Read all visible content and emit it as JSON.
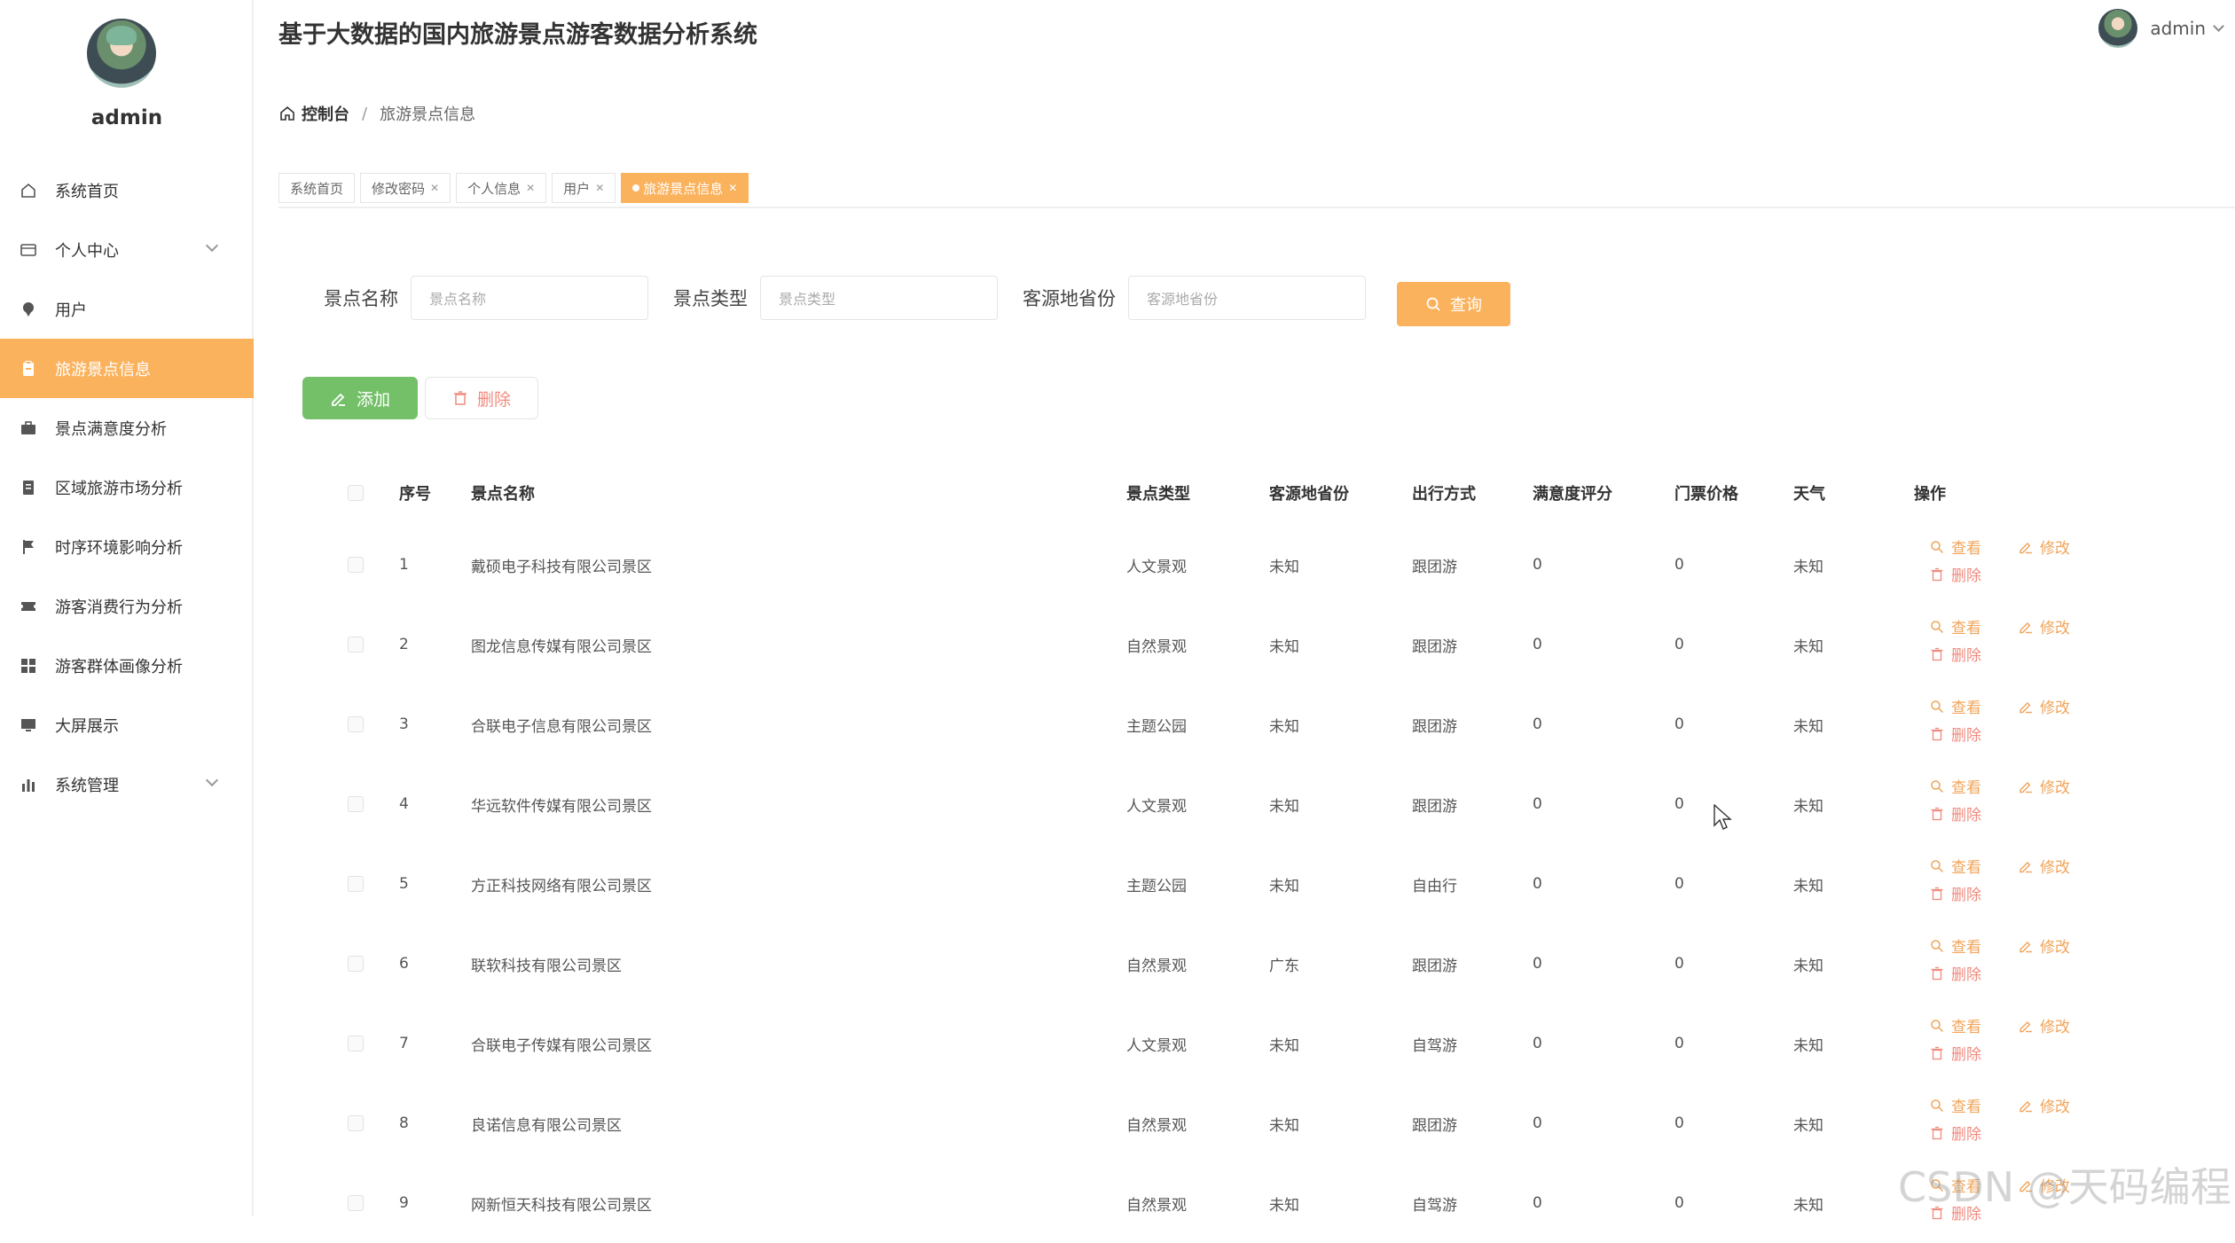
{
  "app": {
    "title": "基于大数据的国内旅游景点游客数据分析系统"
  },
  "sidebar": {
    "username": "admin",
    "items": [
      {
        "label": "系统首页",
        "icon": "home-icon"
      },
      {
        "label": "个人中心",
        "icon": "user-card-icon",
        "expandable": true
      },
      {
        "label": "用户",
        "icon": "user-pin-icon"
      },
      {
        "label": "旅游景点信息",
        "icon": "clipboard-icon",
        "active": true
      },
      {
        "label": "景点满意度分析",
        "icon": "briefcase-icon"
      },
      {
        "label": "区域旅游市场分析",
        "icon": "document-icon"
      },
      {
        "label": "时序环境影响分析",
        "icon": "flag-icon"
      },
      {
        "label": "游客消费行为分析",
        "icon": "ticket-icon"
      },
      {
        "label": "游客群体画像分析",
        "icon": "grid-icon"
      },
      {
        "label": "大屏展示",
        "icon": "monitor-icon"
      },
      {
        "label": "系统管理",
        "icon": "bar-chart-icon",
        "expandable": true
      }
    ]
  },
  "header": {
    "username": "admin"
  },
  "breadcrumb": {
    "home": "控制台",
    "separator": "/",
    "current": "旅游景点信息"
  },
  "tags": [
    {
      "label": "系统首页",
      "closable": false
    },
    {
      "label": "修改密码",
      "closable": true
    },
    {
      "label": "个人信息",
      "closable": true
    },
    {
      "label": "用户",
      "closable": true
    },
    {
      "label": "旅游景点信息",
      "closable": true,
      "active": true
    }
  ],
  "search": {
    "fields": [
      {
        "label": "景点名称",
        "placeholder": "景点名称"
      },
      {
        "label": "景点类型",
        "placeholder": "景点类型"
      },
      {
        "label": "客源地省份",
        "placeholder": "客源地省份"
      }
    ],
    "query_label": "查询"
  },
  "actions": {
    "add_label": "添加",
    "delete_label": "删除"
  },
  "table": {
    "headers": {
      "no": "序号",
      "name": "景点名称",
      "type": "景点类型",
      "province": "客源地省份",
      "travel": "出行方式",
      "satisfaction": "满意度评分",
      "price": "门票价格",
      "weather": "天气",
      "ops": "操作"
    },
    "op_labels": {
      "view": "查看",
      "edit": "修改",
      "delete": "删除"
    },
    "rows": [
      {
        "no": "1",
        "name": "戴硕电子科技有限公司景区",
        "type": "人文景观",
        "province": "未知",
        "travel": "跟团游",
        "satisfaction": "0",
        "price": "0",
        "weather": "未知"
      },
      {
        "no": "2",
        "name": "图龙信息传媒有限公司景区",
        "type": "自然景观",
        "province": "未知",
        "travel": "跟团游",
        "satisfaction": "0",
        "price": "0",
        "weather": "未知"
      },
      {
        "no": "3",
        "name": "合联电子信息有限公司景区",
        "type": "主题公园",
        "province": "未知",
        "travel": "跟团游",
        "satisfaction": "0",
        "price": "0",
        "weather": "未知"
      },
      {
        "no": "4",
        "name": "华远软件传媒有限公司景区",
        "type": "人文景观",
        "province": "未知",
        "travel": "跟团游",
        "satisfaction": "0",
        "price": "0",
        "weather": "未知"
      },
      {
        "no": "5",
        "name": "方正科技网络有限公司景区",
        "type": "主题公园",
        "province": "未知",
        "travel": "自由行",
        "satisfaction": "0",
        "price": "0",
        "weather": "未知"
      },
      {
        "no": "6",
        "name": "联软科技有限公司景区",
        "type": "自然景观",
        "province": "广东",
        "travel": "跟团游",
        "satisfaction": "0",
        "price": "0",
        "weather": "未知"
      },
      {
        "no": "7",
        "name": "合联电子传媒有限公司景区",
        "type": "人文景观",
        "province": "未知",
        "travel": "自驾游",
        "satisfaction": "0",
        "price": "0",
        "weather": "未知"
      },
      {
        "no": "8",
        "name": "良诺信息有限公司景区",
        "type": "自然景观",
        "province": "未知",
        "travel": "跟团游",
        "satisfaction": "0",
        "price": "0",
        "weather": "未知"
      },
      {
        "no": "9",
        "name": "网新恒天科技有限公司景区",
        "type": "自然景观",
        "province": "未知",
        "travel": "自驾游",
        "satisfaction": "0",
        "price": "0",
        "weather": "未知"
      }
    ]
  },
  "watermark": "CSDN @天码编程",
  "colors": {
    "accent": "#fbb25d",
    "add_button": "#74c069",
    "delete_text": "#f08a7d"
  }
}
